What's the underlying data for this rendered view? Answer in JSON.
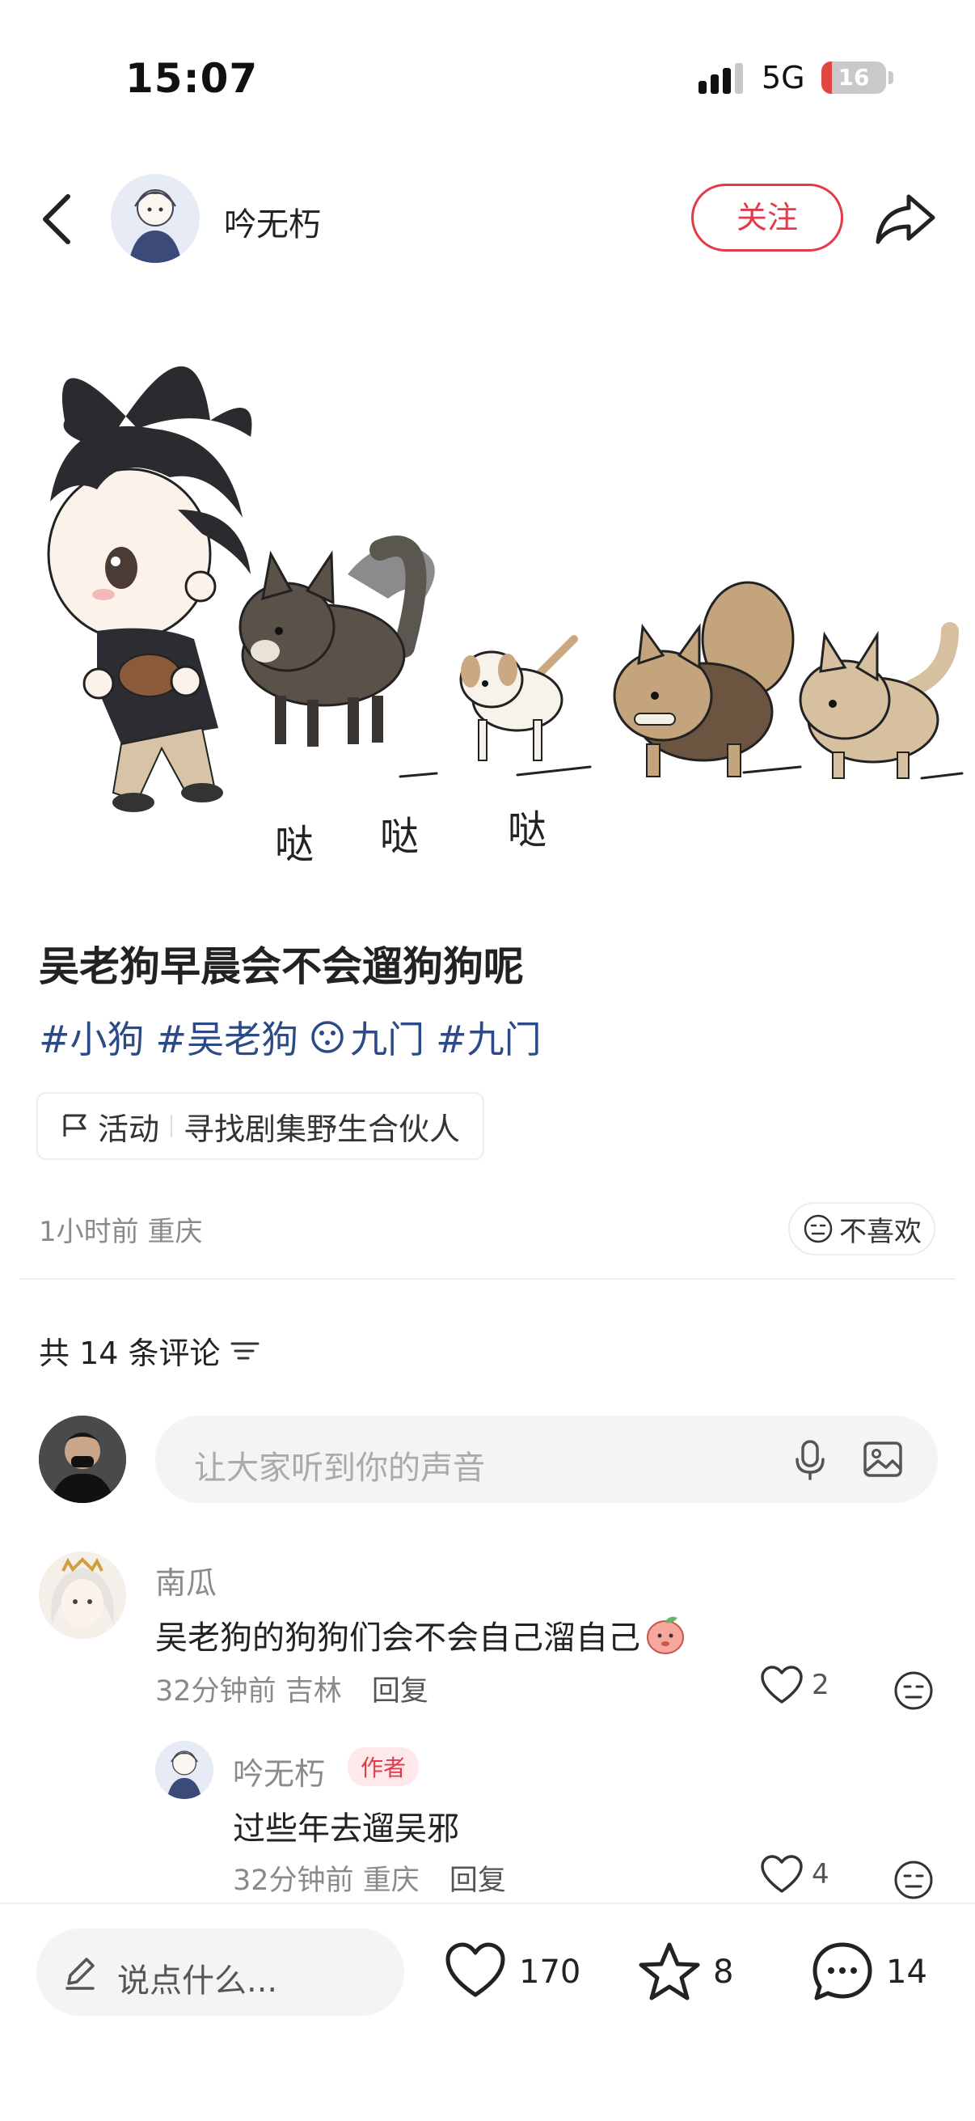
{
  "status_bar": {
    "time": "15:07",
    "network": "5G",
    "battery": "16",
    "battery_level": 0.16
  },
  "nav": {
    "author_name": "吟无朽",
    "follow_label": "关注"
  },
  "post": {
    "title": "吴老狗早晨会不会遛狗狗呢",
    "tags": [
      "#小狗",
      "#吴老狗",
      "九门",
      "#九门"
    ],
    "illustration_text": [
      "哒",
      "哒",
      "哒"
    ],
    "activity_label": "活动",
    "activity_text": "寻找剧集野生合伙人",
    "time_location": "1小时前 重庆",
    "dislike_label": "不喜欢"
  },
  "comments_section": {
    "count_label": "共 14 条评论",
    "input_placeholder": "让大家听到你的声音",
    "comments": [
      {
        "name": "南瓜",
        "text": "吴老狗的狗狗们会不会自己溜自己",
        "time": "32分钟前",
        "location": "吉林",
        "reply_label": "回复",
        "likes": "2"
      },
      {
        "name": "吟无朽",
        "badge": "作者",
        "text": "过些年去遛吴邪",
        "time": "32分钟前",
        "location": "重庆",
        "reply_label": "回复",
        "likes": "4"
      }
    ]
  },
  "bottom_bar": {
    "placeholder": "说点什么...",
    "likes": "170",
    "stars": "8",
    "comments": "14"
  },
  "colors": {
    "accent": "#e33a4a",
    "tag": "#2c4a87",
    "muted": "#8a8a8a"
  },
  "icons": [
    "back-icon",
    "share-icon",
    "tag-topic-icon",
    "dislike-face-icon",
    "filter-icon",
    "mic-icon",
    "image-icon",
    "heart-icon",
    "star-icon",
    "comment-icon",
    "pencil-icon"
  ]
}
